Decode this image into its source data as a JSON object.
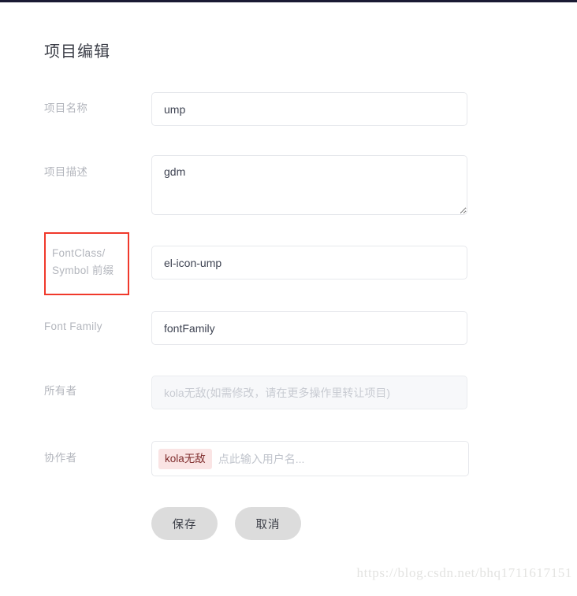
{
  "window": {
    "accent_bar_color": "#1a1a33",
    "background": "#ffffff"
  },
  "form": {
    "title": "项目编辑",
    "rows": [
      {
        "label": "项目名称",
        "value": "ump",
        "type": "input"
      },
      {
        "label": "项目描述",
        "value": "gdm",
        "type": "textarea"
      },
      {
        "label_line1": "FontClass/",
        "label_line2": "Symbol 前缀",
        "label": "FontClass/Symbol 前缀",
        "value": "el-icon-ump",
        "type": "input",
        "highlighted": true,
        "highlight_color": "#f0392b"
      },
      {
        "label": "Font Family",
        "value": "fontFamily",
        "type": "input"
      },
      {
        "label": "所有者",
        "value": "",
        "placeholder": "kola无敌(如需修改，请在更多操作里转让项目)",
        "type": "input",
        "disabled": true
      },
      {
        "label": "协作者",
        "type": "tags",
        "tags": [
          "kola无敌"
        ],
        "placeholder": "点此输入用户名...",
        "tag_bg": "#fae4e4",
        "tag_color": "#7e2b2b"
      }
    ],
    "buttons": {
      "save": "保存",
      "cancel": "取消"
    }
  },
  "watermark": {
    "text": "https://blog.csdn.net/bhq1711617151"
  }
}
